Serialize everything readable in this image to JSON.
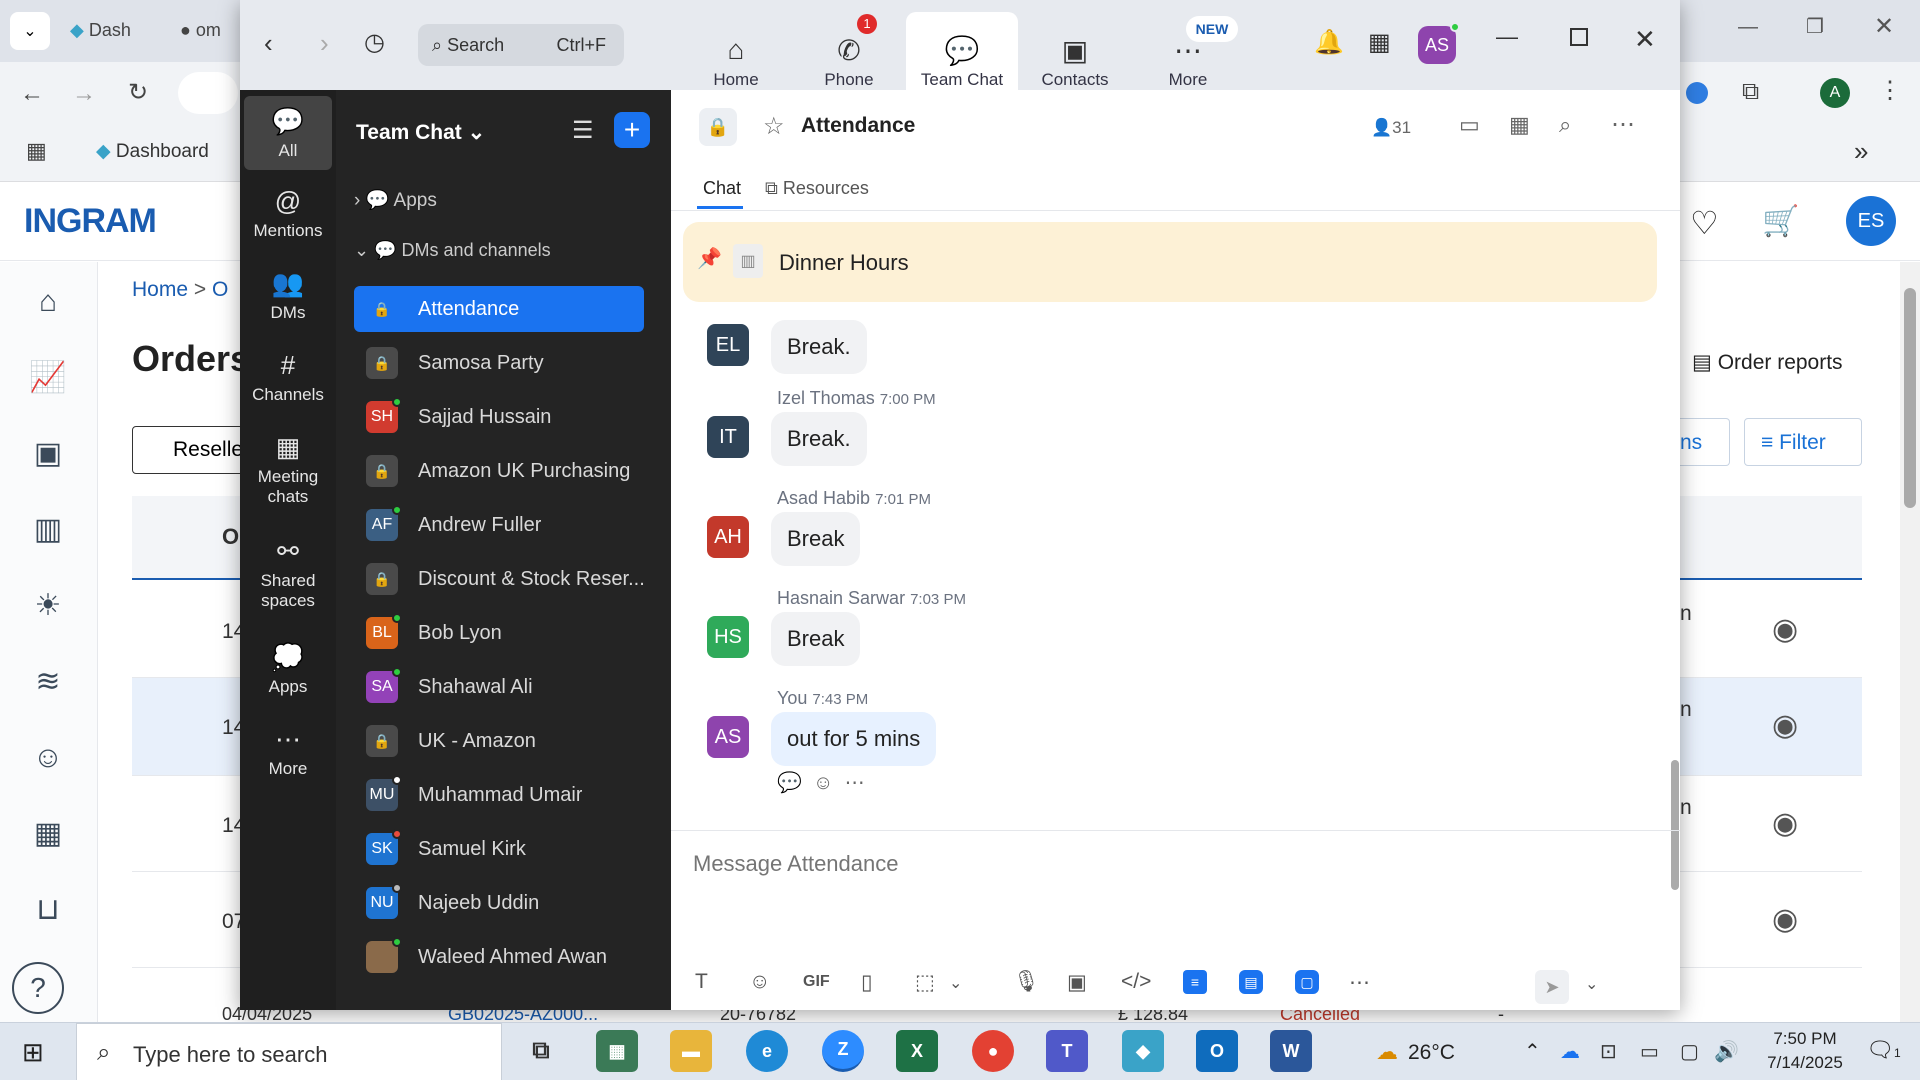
{
  "browser": {
    "tabs": [
      {
        "label": "Dash"
      },
      {
        "label": "om"
      }
    ],
    "bookmark": "Dashboard",
    "profile_initial": "A"
  },
  "site": {
    "logo": "INGRAM",
    "breadcrumb_home": "Home",
    "breadcrumb_sep": ">",
    "breadcrumb_next": "O",
    "page_title": "Orders",
    "reseller_btn": "Reselle",
    "order_reports": "Order reports",
    "filter": "Filter",
    "user_initials": "ES",
    "partial_btn": "ns",
    "col_head": "O",
    "rows": [
      {
        "id": "14",
        "status": "n"
      },
      {
        "id": "14",
        "status": "n"
      },
      {
        "id": "14",
        "status": "n"
      },
      {
        "id": "07",
        "status": ""
      }
    ],
    "bottom_row": {
      "date": "04/04/2025",
      "order": "GB02025-AZ000...",
      "ref": "20-76782",
      "amount": "£ 128.84",
      "status": "Cancelled",
      "dash": "-"
    }
  },
  "zoom": {
    "nav": {
      "search_label": "Search",
      "search_shortcut": "Ctrl+F",
      "tabs": [
        {
          "label": "Home"
        },
        {
          "label": "Phone",
          "badge": "1"
        },
        {
          "label": "Team Chat"
        },
        {
          "label": "Contacts"
        },
        {
          "label": "More",
          "badge": "NEW"
        }
      ],
      "avatar": "AS"
    },
    "sidenav": [
      {
        "label": "All"
      },
      {
        "label": "Mentions"
      },
      {
        "label": "DMs"
      },
      {
        "label": "Channels"
      },
      {
        "label": "Meeting chats"
      },
      {
        "label": "Shared spaces"
      },
      {
        "label": "Apps"
      },
      {
        "label": "More"
      }
    ],
    "list": {
      "title": "Team Chat",
      "section_apps": "Apps",
      "section_dms": "DMs and channels",
      "items": [
        {
          "label": "Attendance",
          "type": "lock",
          "selected": true
        },
        {
          "label": "Samosa Party",
          "type": "lock"
        },
        {
          "label": "Sajjad Hussain",
          "initials": "SH",
          "color": "#d13b2f"
        },
        {
          "label": "Amazon UK Purchasing",
          "type": "lock"
        },
        {
          "label": "Andrew Fuller",
          "initials": "AF",
          "color": "#3b5f83"
        },
        {
          "label": "Discount & Stock Reser...",
          "type": "lock"
        },
        {
          "label": "Bob Lyon",
          "initials": "BL",
          "color": "#d9641a"
        },
        {
          "label": "Shahawal Ali",
          "initials": "SA",
          "color": "#9342b8"
        },
        {
          "label": "UK - Amazon",
          "type": "lock"
        },
        {
          "label": "Muhammad Umair",
          "initials": "MU",
          "color": "#3d5066"
        },
        {
          "label": "Samuel Kirk",
          "initials": "SK",
          "color": "#1f74d1"
        },
        {
          "label": "Najeeb Uddin",
          "initials": "NU",
          "color": "#1f74d1"
        },
        {
          "label": "Waleed Ahmed Awan",
          "initials": "",
          "color": "#8a6a4a"
        }
      ]
    },
    "chat": {
      "title": "Attendance",
      "members": "31",
      "tab_chat": "Chat",
      "tab_resources": "Resources",
      "pinned": "Dinner Hours",
      "messages": [
        {
          "initials": "EL",
          "color": "#2f4458",
          "author": "",
          "time": "",
          "text": "Break."
        },
        {
          "initials": "IT",
          "color": "#2f4458",
          "author": "Izel Thomas",
          "time": "7:00 PM",
          "text": "Break."
        },
        {
          "initials": "AH",
          "color": "#c3392b",
          "author": "Asad Habib",
          "time": "7:01 PM",
          "text": "Break"
        },
        {
          "initials": "HS",
          "color": "#2faa5a",
          "author": "Hasnain Sarwar",
          "time": "7:03 PM",
          "text": "Break"
        },
        {
          "initials": "AS",
          "color": "#8e44ad",
          "author": "You",
          "time": "7:43 PM",
          "text": "out for 5 mins"
        }
      ],
      "composer_placeholder": "Message Attendance",
      "gif": "GIF"
    }
  },
  "taskbar": {
    "search": "Type here to search",
    "temp": "26°C",
    "time": "7:50 PM",
    "date": "7/14/2025",
    "notif": "1"
  }
}
